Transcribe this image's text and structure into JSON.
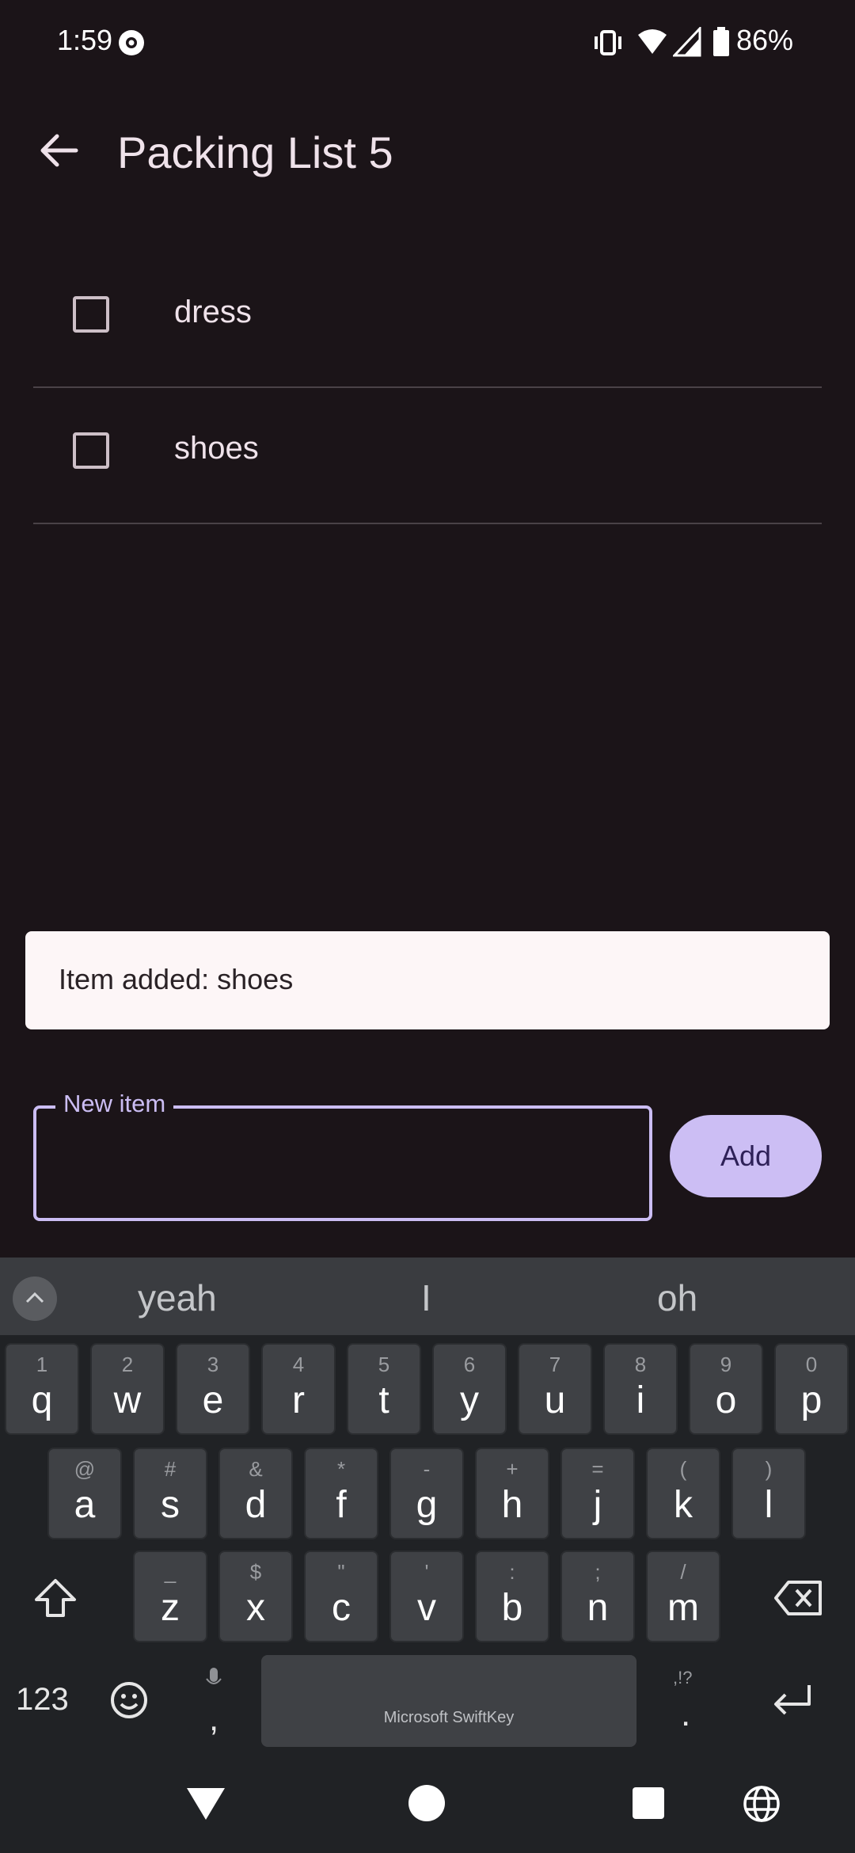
{
  "status": {
    "time": "1:59",
    "battery": "86%"
  },
  "appbar": {
    "title": "Packing List 5"
  },
  "items": [
    {
      "label": "dress",
      "checked": false
    },
    {
      "label": "shoes",
      "checked": false
    }
  ],
  "snackbar": {
    "text": "Item added: shoes"
  },
  "input": {
    "label": "New item",
    "value": ""
  },
  "add_button": {
    "label": "Add"
  },
  "keyboard": {
    "suggestions": [
      "yeah",
      "I",
      "oh"
    ],
    "row1": [
      {
        "k": "q",
        "a": "1"
      },
      {
        "k": "w",
        "a": "2"
      },
      {
        "k": "e",
        "a": "3"
      },
      {
        "k": "r",
        "a": "4"
      },
      {
        "k": "t",
        "a": "5"
      },
      {
        "k": "y",
        "a": "6"
      },
      {
        "k": "u",
        "a": "7"
      },
      {
        "k": "i",
        "a": "8"
      },
      {
        "k": "o",
        "a": "9"
      },
      {
        "k": "p",
        "a": "0"
      }
    ],
    "row2": [
      {
        "k": "a",
        "a": "@"
      },
      {
        "k": "s",
        "a": "#"
      },
      {
        "k": "d",
        "a": "&"
      },
      {
        "k": "f",
        "a": "*"
      },
      {
        "k": "g",
        "a": "-"
      },
      {
        "k": "h",
        "a": "+"
      },
      {
        "k": "j",
        "a": "="
      },
      {
        "k": "k",
        "a": "("
      },
      {
        "k": "l",
        "a": ")"
      }
    ],
    "row3": [
      {
        "k": "z",
        "a": "_"
      },
      {
        "k": "x",
        "a": "$"
      },
      {
        "k": "c",
        "a": "\""
      },
      {
        "k": "v",
        "a": "'"
      },
      {
        "k": "b",
        "a": ":"
      },
      {
        "k": "n",
        "a": ";"
      },
      {
        "k": "m",
        "a": "/"
      }
    ],
    "numbers_key": "123",
    "comma_key": ",",
    "period_key": ".",
    "period_alt": ",!?",
    "space_label": "Microsoft SwiftKey"
  },
  "colors": {
    "accent": "#ccbef4",
    "background": "#1b1418",
    "snackbar": "#fdf6f7"
  },
  "icons": [
    "eye-icon",
    "vibrate-icon",
    "wifi-icon",
    "signal-icon",
    "battery-icon",
    "back-icon",
    "shift-icon",
    "backspace-icon",
    "emoji-icon",
    "mic-icon",
    "enter-icon",
    "nav-back-icon",
    "nav-home-icon",
    "nav-recents-icon",
    "globe-icon"
  ]
}
